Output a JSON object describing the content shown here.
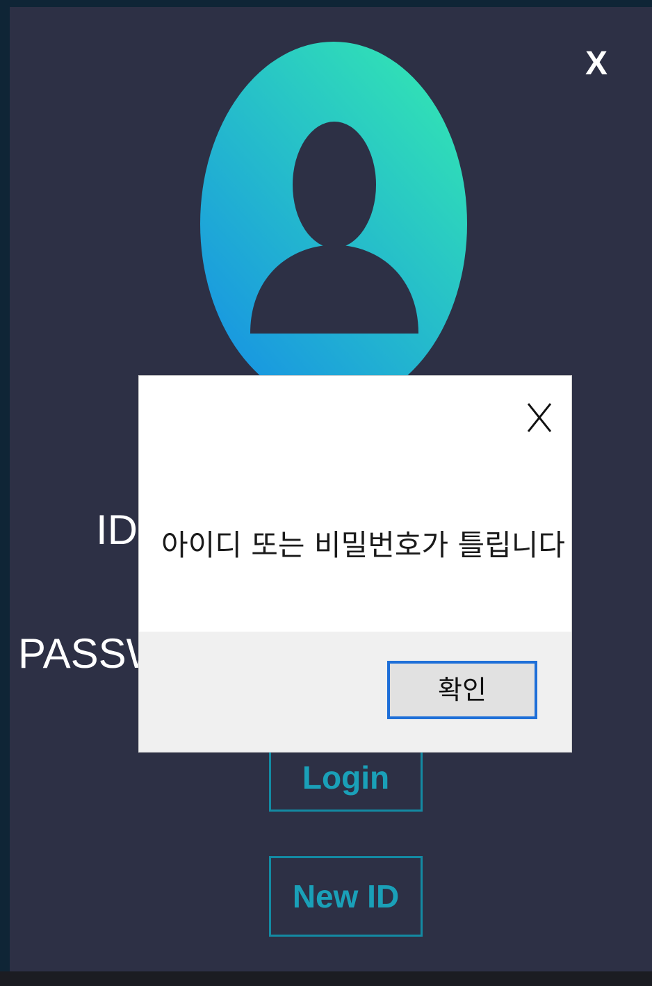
{
  "window": {
    "close_label": "X"
  },
  "avatar": {
    "icon": "user-avatar-icon",
    "gradient_colors": [
      "#30dcb8",
      "#1aa0e0"
    ]
  },
  "form": {
    "id_label": "ID",
    "password_label": "PASSW"
  },
  "buttons": {
    "login_label": "Login",
    "new_id_label": "New ID",
    "accent_color": "#138aa3"
  },
  "dialog": {
    "close_icon": "close-icon",
    "message": "아이디 또는 비밀번호가 틀립니다",
    "ok_label": "확인",
    "ok_border_color": "#1e6fd8"
  },
  "colors": {
    "background": "#2d3045",
    "frame": "#0f2536",
    "text": "#ffffff"
  }
}
